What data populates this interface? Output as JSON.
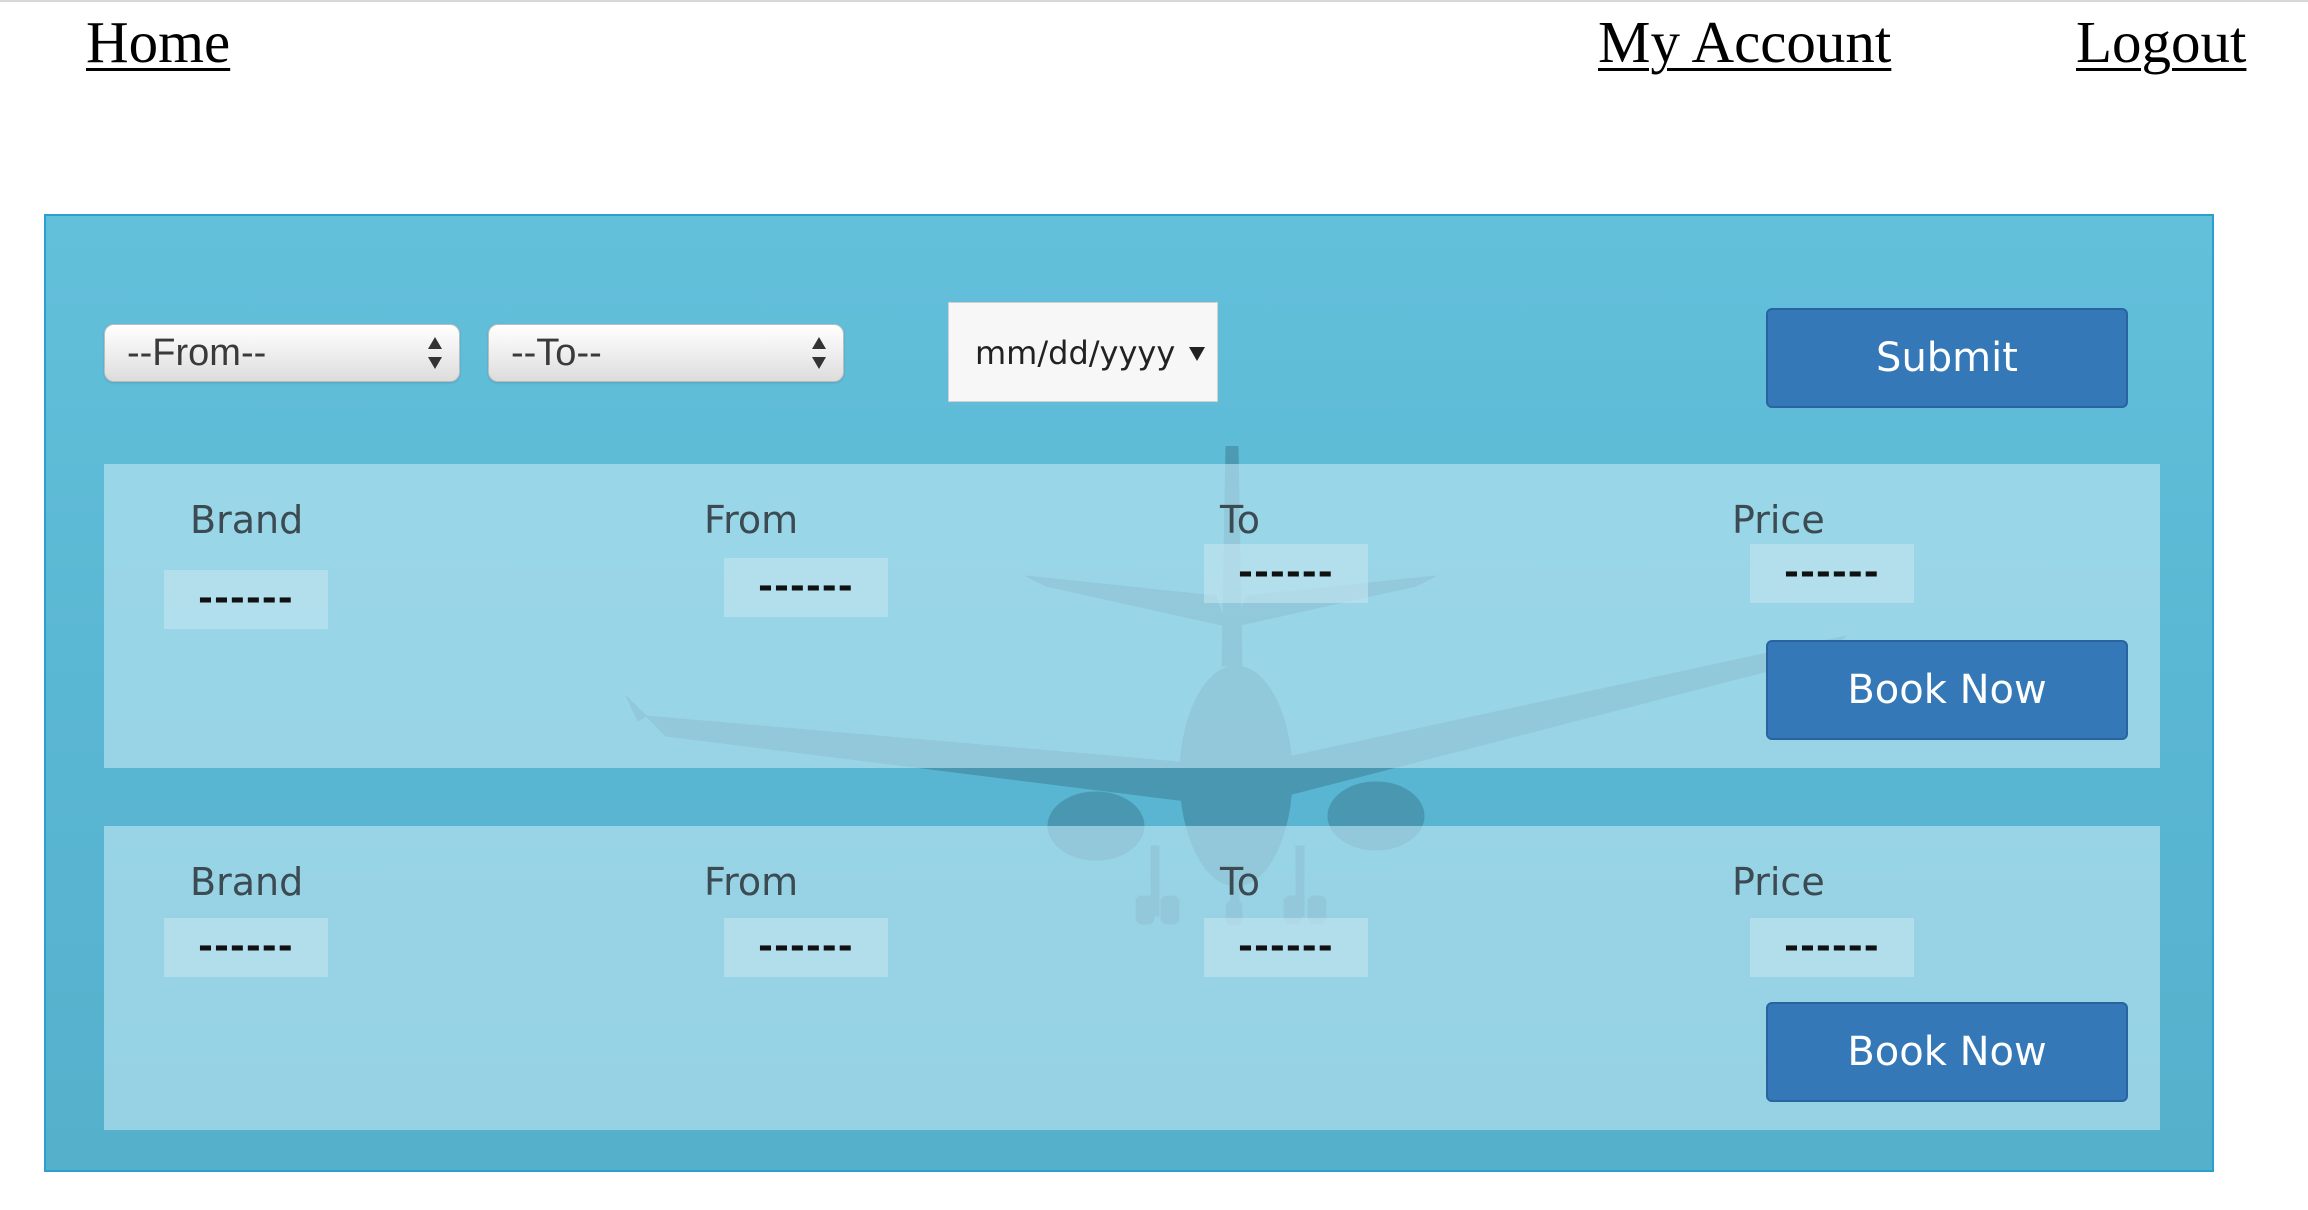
{
  "nav": {
    "home": "Home",
    "account": "My Account",
    "logout": "Logout"
  },
  "search": {
    "from_select": "--From--",
    "to_select": "--To--",
    "date_placeholder": "mm/dd/yyyy",
    "submit": "Submit"
  },
  "results": [
    {
      "brand_label": "Brand",
      "from_label": "From",
      "to_label": "To",
      "price_label": "Price",
      "brand": "------",
      "from": "------",
      "to": "------",
      "price": "------",
      "book": "Book Now"
    },
    {
      "brand_label": "Brand",
      "from_label": "From",
      "to_label": "To",
      "price_label": "Price",
      "brand": "------",
      "from": "------",
      "to": "------",
      "price": "------",
      "book": "Book Now"
    }
  ],
  "colors": {
    "panel": "#5ab7d3",
    "panel_border": "#2b9fd0",
    "button": "#3478b8",
    "card": "#bee6f2"
  },
  "icons": {
    "background": "airplane-photo",
    "select_arrows": "up-down-arrows-icon",
    "date_dropdown": "caret-down-icon"
  }
}
